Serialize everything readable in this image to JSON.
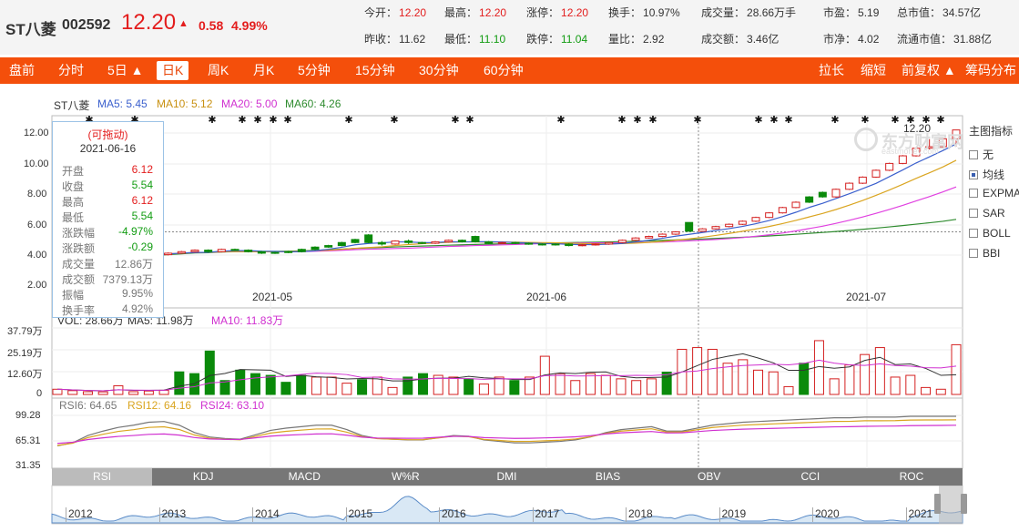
{
  "stock": {
    "name": "ST八菱",
    "code": "002592",
    "price": "12.20",
    "arrow": "▲",
    "change": "0.58",
    "pct": "4.99%"
  },
  "quotes": {
    "open": {
      "label": "今开：",
      "value": "12.20"
    },
    "high": {
      "label": "最高：",
      "value": "12.20"
    },
    "limit_up": {
      "label": "涨停：",
      "value": "12.20"
    },
    "turnover": {
      "label": "换手：",
      "value": "10.97%"
    },
    "volume": {
      "label": "成交量：",
      "value": "28.66万手"
    },
    "pe": {
      "label": "市盈：",
      "value": "5.19"
    },
    "mktcap": {
      "label": "总市值：",
      "value": "34.57亿"
    },
    "prev_close": {
      "label": "昨收：",
      "value": "11.62"
    },
    "low": {
      "label": "最低：",
      "value": "11.10"
    },
    "limit_down": {
      "label": "跌停：",
      "value": "11.04"
    },
    "vol_ratio": {
      "label": "量比：",
      "value": "2.92"
    },
    "amount": {
      "label": "成交额：",
      "value": "3.46亿"
    },
    "pb": {
      "label": "市净：",
      "value": "4.02"
    },
    "float_cap": {
      "label": "流通市值：",
      "value": "31.88亿"
    }
  },
  "nav": {
    "items": [
      "盘前",
      "分时",
      "5日 ▲",
      "日K",
      "周K",
      "月K",
      "5分钟",
      "15分钟",
      "30分钟",
      "60分钟"
    ],
    "right": [
      "拉长",
      "缩短",
      "前复权 ▲",
      "筹码分布"
    ]
  },
  "legend": {
    "symbol": "ST八菱",
    "ma5": "MA5: 5.45",
    "ma10": "MA10: 5.12",
    "ma20": "MA20: 5.00",
    "ma60": "MA60: 4.26"
  },
  "colors": {
    "ma5": "#3a5fcd",
    "ma10": "#daa520",
    "ma20": "#e040e0",
    "ma60": "#2e8b2e",
    "up": "#d42020",
    "down": "#0a8a0a",
    "nav": "#f44f0b"
  },
  "side": {
    "title": "主图指标",
    "options": [
      "无",
      "均线",
      "EXPMA",
      "SAR",
      "BOLL",
      "BBI"
    ],
    "selected": "均线"
  },
  "tooltip": {
    "drag": "(可拖动)",
    "date": "2021-06-16",
    "rows": [
      {
        "k": "开盘",
        "v": "6.12",
        "c": "red"
      },
      {
        "k": "收盘",
        "v": "5.54",
        "c": "green"
      },
      {
        "k": "最高",
        "v": "6.12",
        "c": "red"
      },
      {
        "k": "最低",
        "v": "5.54",
        "c": "green"
      },
      {
        "k": "涨跌幅",
        "v": "-4.97%",
        "c": "green"
      },
      {
        "k": "涨跌额",
        "v": "-0.29",
        "c": "green"
      },
      {
        "k": "成交量",
        "v": "12.86万",
        "c": "gray"
      },
      {
        "k": "成交额",
        "v": "7379.13万",
        "c": "gray"
      },
      {
        "k": "振幅",
        "v": "9.95%",
        "c": "gray"
      },
      {
        "k": "换手率",
        "v": "4.92%",
        "c": "gray"
      }
    ]
  },
  "watermark": "东方财富网",
  "watermark_sub": "eastmoney.com",
  "price_axis": {
    "ticks": [
      "12.00",
      "10.00",
      "8.00",
      "6.00",
      "4.00",
      "2.00"
    ],
    "max_label": "12.20"
  },
  "x_axis": {
    "ticks": [
      "2021-05",
      "2021-06",
      "2021-07"
    ]
  },
  "vol_axis": {
    "ticks": [
      "37.79万",
      "25.19万",
      "12.60万",
      "0"
    ]
  },
  "vol_legend": {
    "vol": "VOL: 28.66万",
    "ma5": "MA5: 11.98万",
    "ma10": "MA10: 11.83万"
  },
  "rsi_axis": {
    "ticks": [
      "99.28",
      "65.31",
      "31.35"
    ]
  },
  "rsi_legend": {
    "rsi6": "RSI6: 64.65",
    "rsi12": "RSI12: 64.16",
    "rsi24": "RSI24: 63.10"
  },
  "tabs": [
    "RSI",
    "KDJ",
    "MACD",
    "W%R",
    "DMI",
    "BIAS",
    "OBV",
    "CCI",
    "ROC"
  ],
  "active_tab": "RSI",
  "years": [
    "2012",
    "2013",
    "2014",
    "2015",
    "2016",
    "2017",
    "2018",
    "2019",
    "2020",
    "2021"
  ],
  "chart_data": {
    "type": "candlestick",
    "x_range": [
      "2021-04",
      "2021-07"
    ],
    "ylim": [
      2.0,
      12.2
    ],
    "candles": [
      {
        "o": 3.9,
        "c": 4.0,
        "h": 4.05,
        "l": 3.85
      },
      {
        "o": 4.0,
        "c": 4.1,
        "h": 4.15,
        "l": 3.95
      },
      {
        "o": 4.1,
        "c": 4.2,
        "h": 4.25,
        "l": 4.05
      },
      {
        "o": 4.2,
        "c": 4.3,
        "h": 4.35,
        "l": 4.15
      },
      {
        "o": 4.3,
        "c": 4.2,
        "h": 4.35,
        "l": 4.15
      },
      {
        "o": 4.2,
        "c": 4.35,
        "h": 4.4,
        "l": 4.15
      },
      {
        "o": 4.35,
        "c": 4.3,
        "h": 4.4,
        "l": 4.25
      },
      {
        "o": 4.3,
        "c": 4.2,
        "h": 4.35,
        "l": 4.15
      },
      {
        "o": 4.2,
        "c": 4.1,
        "h": 4.25,
        "l": 4.05
      },
      {
        "o": 4.1,
        "c": 4.15,
        "h": 4.2,
        "l": 4.05
      },
      {
        "o": 4.15,
        "c": 4.2,
        "h": 4.25,
        "l": 4.1
      },
      {
        "o": 4.2,
        "c": 4.35,
        "h": 4.4,
        "l": 4.15
      },
      {
        "o": 4.35,
        "c": 4.5,
        "h": 4.55,
        "l": 4.3
      },
      {
        "o": 4.5,
        "c": 4.6,
        "h": 4.65,
        "l": 4.45
      },
      {
        "o": 4.6,
        "c": 4.8,
        "h": 4.85,
        "l": 4.55
      },
      {
        "o": 4.8,
        "c": 5.0,
        "h": 5.05,
        "l": 4.75
      },
      {
        "o": 5.3,
        "c": 4.8,
        "h": 5.35,
        "l": 4.75
      },
      {
        "o": 4.8,
        "c": 4.7,
        "h": 4.9,
        "l": 4.6
      },
      {
        "o": 4.7,
        "c": 4.9,
        "h": 4.95,
        "l": 4.65
      },
      {
        "o": 4.9,
        "c": 4.8,
        "h": 5.0,
        "l": 4.7
      },
      {
        "o": 4.8,
        "c": 4.75,
        "h": 4.85,
        "l": 4.7
      },
      {
        "o": 4.75,
        "c": 4.85,
        "h": 4.9,
        "l": 4.7
      },
      {
        "o": 4.85,
        "c": 4.95,
        "h": 5.0,
        "l": 4.8
      },
      {
        "o": 4.95,
        "c": 4.85,
        "h": 5.0,
        "l": 4.8
      },
      {
        "o": 5.2,
        "c": 4.85,
        "h": 5.25,
        "l": 4.8
      },
      {
        "o": 4.85,
        "c": 4.75,
        "h": 4.9,
        "l": 4.7
      },
      {
        "o": 4.75,
        "c": 4.8,
        "h": 4.85,
        "l": 4.7
      },
      {
        "o": 4.8,
        "c": 4.75,
        "h": 4.85,
        "l": 4.7
      },
      {
        "o": 4.75,
        "c": 4.7,
        "h": 4.8,
        "l": 4.65
      },
      {
        "o": 4.7,
        "c": 4.65,
        "h": 4.75,
        "l": 4.6
      },
      {
        "o": 4.65,
        "c": 4.7,
        "h": 4.75,
        "l": 4.6
      },
      {
        "o": 4.7,
        "c": 4.6,
        "h": 4.75,
        "l": 4.55
      },
      {
        "o": 4.6,
        "c": 4.65,
        "h": 4.7,
        "l": 4.55
      },
      {
        "o": 4.65,
        "c": 4.7,
        "h": 4.75,
        "l": 4.6
      },
      {
        "o": 4.7,
        "c": 4.8,
        "h": 4.85,
        "l": 4.65
      },
      {
        "o": 4.8,
        "c": 4.95,
        "h": 5.0,
        "l": 4.75
      },
      {
        "o": 4.95,
        "c": 5.1,
        "h": 5.15,
        "l": 4.9
      },
      {
        "o": 5.1,
        "c": 5.2,
        "h": 5.25,
        "l": 5.05
      },
      {
        "o": 5.2,
        "c": 5.35,
        "h": 5.4,
        "l": 5.15
      },
      {
        "o": 5.35,
        "c": 5.5,
        "h": 5.55,
        "l": 5.3
      },
      {
        "o": 6.12,
        "c": 5.54,
        "h": 6.12,
        "l": 5.54
      },
      {
        "o": 5.54,
        "c": 5.7,
        "h": 5.75,
        "l": 5.5
      },
      {
        "o": 5.7,
        "c": 5.85,
        "h": 5.9,
        "l": 5.65
      },
      {
        "o": 5.85,
        "c": 6.0,
        "h": 6.05,
        "l": 5.8
      },
      {
        "o": 6.0,
        "c": 6.2,
        "h": 6.25,
        "l": 5.95
      },
      {
        "o": 6.2,
        "c": 6.45,
        "h": 6.5,
        "l": 6.15
      },
      {
        "o": 6.45,
        "c": 6.75,
        "h": 6.8,
        "l": 6.4
      },
      {
        "o": 6.75,
        "c": 7.1,
        "h": 7.15,
        "l": 6.7
      },
      {
        "o": 7.1,
        "c": 7.45,
        "h": 7.5,
        "l": 7.05
      },
      {
        "o": 7.45,
        "c": 7.8,
        "h": 7.85,
        "l": 7.4
      },
      {
        "o": 8.1,
        "c": 7.8,
        "h": 8.15,
        "l": 7.75
      },
      {
        "o": 7.8,
        "c": 8.3,
        "h": 8.35,
        "l": 7.75
      },
      {
        "o": 8.3,
        "c": 8.7,
        "h": 8.75,
        "l": 8.25
      },
      {
        "o": 8.7,
        "c": 9.1,
        "h": 9.15,
        "l": 8.65
      },
      {
        "o": 9.1,
        "c": 9.55,
        "h": 9.6,
        "l": 9.05
      },
      {
        "o": 9.55,
        "c": 10.0,
        "h": 10.05,
        "l": 9.5
      },
      {
        "o": 10.0,
        "c": 10.5,
        "h": 10.55,
        "l": 9.95
      },
      {
        "o": 10.5,
        "c": 11.0,
        "h": 11.05,
        "l": 10.45
      },
      {
        "o": 11.0,
        "c": 11.1,
        "h": 11.6,
        "l": 10.9
      },
      {
        "o": 11.1,
        "c": 11.62,
        "h": 11.65,
        "l": 11.05
      },
      {
        "o": 11.62,
        "c": 12.2,
        "h": 12.2,
        "l": 11.1
      }
    ],
    "volumes": [
      3.0,
      2.2,
      1.6,
      1.5,
      5.0,
      1.6,
      2.0,
      2.4,
      13.0,
      12.0,
      25.0,
      8.0,
      14.0,
      12.0,
      11.0,
      7.0,
      11.0,
      10.0,
      10.0,
      6.5,
      8.5,
      10.0,
      4.0,
      10.0,
      12.0,
      11.0,
      10.0,
      9.0,
      6.0,
      10.0,
      8.0,
      10.0,
      22.0,
      12.0,
      8.0,
      12.0,
      11.0,
      9.0,
      8.0,
      9.0,
      12.86,
      26.0,
      27.0,
      26.0,
      18.0,
      20.0,
      14.0,
      13.0,
      4.5,
      18.0,
      31.0,
      9.0,
      17.0,
      23.0,
      27.0,
      10.0,
      11.0,
      4.0,
      3.0,
      28.66
    ],
    "down_idx": [
      8,
      9,
      10,
      11,
      12,
      13,
      14,
      15,
      16,
      20,
      23,
      24,
      27,
      30,
      40,
      49
    ]
  }
}
